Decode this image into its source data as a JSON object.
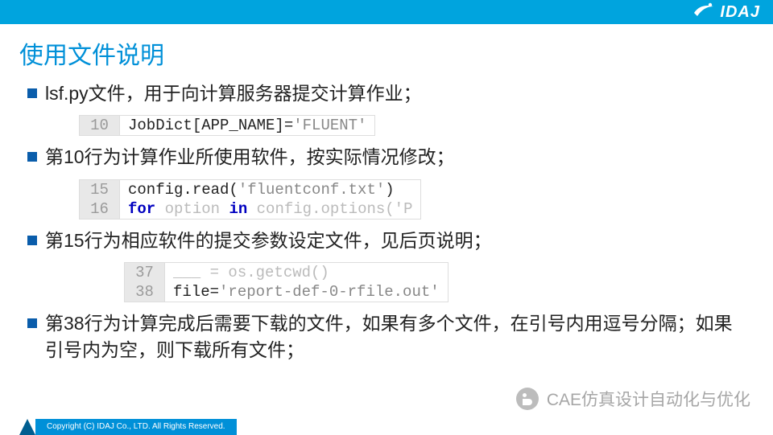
{
  "brand": "IDAJ",
  "title": "使用文件说明",
  "bullets": {
    "b1": "lsf.py文件，用于向计算服务器提交计算作业；",
    "b2": "第10行为计算作业所使用软件，按实际情况修改；",
    "b3": "第15行为相应软件的提交参数设定文件，见后页说明；",
    "b4": "第38行为计算完成后需要下载的文件，如果有多个文件，在引号内用逗号分隔；如果引号内为空，则下载所有文件；"
  },
  "code1": {
    "ln": "10",
    "pre": "JobDict[APP_NAME]=",
    "str": "'FLUENT'"
  },
  "code2": {
    "ln1": "15",
    "pre1": "config.read(",
    "str1": "'fluentconf.txt'",
    "post1": ")",
    "ln2": "16",
    "kw2a": "for",
    "mid2": " option ",
    "kw2b": "in",
    "tail2": " config.options('P"
  },
  "code3": {
    "ln0": "37",
    "txt0": "___ = os.getcwd()",
    "ln1": "38",
    "pre1": "file=",
    "str1": "'report-def-0-rfile.out'"
  },
  "footer": "Copyright (C)  IDAJ Co., LTD. All Rights Reserved.",
  "watermark": "CAE仿真设计自动化与优化"
}
